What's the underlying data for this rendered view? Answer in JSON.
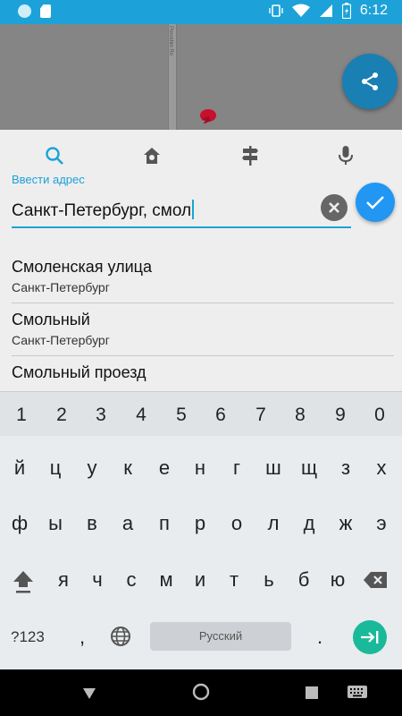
{
  "status_bar": {
    "time": "6:12",
    "left_icons": [
      "circle-icon",
      "sd-card-icon"
    ],
    "right_icons": [
      "vibrate-icon",
      "wifi-icon",
      "signal-icon",
      "battery-charging-icon"
    ]
  },
  "map": {
    "road_label": "Poroshin Ro"
  },
  "panel": {
    "tabs": [
      {
        "name": "search",
        "icon": "search-icon"
      },
      {
        "name": "home",
        "icon": "home-pin-icon"
      },
      {
        "name": "directions",
        "icon": "signpost-icon"
      },
      {
        "name": "voice",
        "icon": "microphone-icon"
      }
    ],
    "active_tab_label": "Ввести адрес",
    "input_value": "Санкт-Петербург, смол",
    "results": [
      {
        "title": "Смоленская улица",
        "subtitle": "Санкт-Петербург"
      },
      {
        "title": "Смольный",
        "subtitle": "Санкт-Петербург"
      },
      {
        "title": "Смольный проезд",
        "subtitle": ""
      }
    ]
  },
  "keyboard": {
    "numbers": [
      "1",
      "2",
      "3",
      "4",
      "5",
      "6",
      "7",
      "8",
      "9",
      "0"
    ],
    "row1": [
      "й",
      "ц",
      "у",
      "к",
      "е",
      "н",
      "г",
      "ш",
      "щ",
      "з",
      "х"
    ],
    "row2": [
      "ф",
      "ы",
      "в",
      "а",
      "п",
      "р",
      "о",
      "л",
      "д",
      "ж",
      "э"
    ],
    "row3": [
      "я",
      "ч",
      "с",
      "м",
      "и",
      "т",
      "ь",
      "б",
      "ю"
    ],
    "symbols_label": "?123",
    "comma": ",",
    "period": ".",
    "space_label": "Русский"
  },
  "colors": {
    "accent": "#1ca2d8",
    "fab_blue": "#2196f3",
    "enter_green": "#1ab999"
  }
}
